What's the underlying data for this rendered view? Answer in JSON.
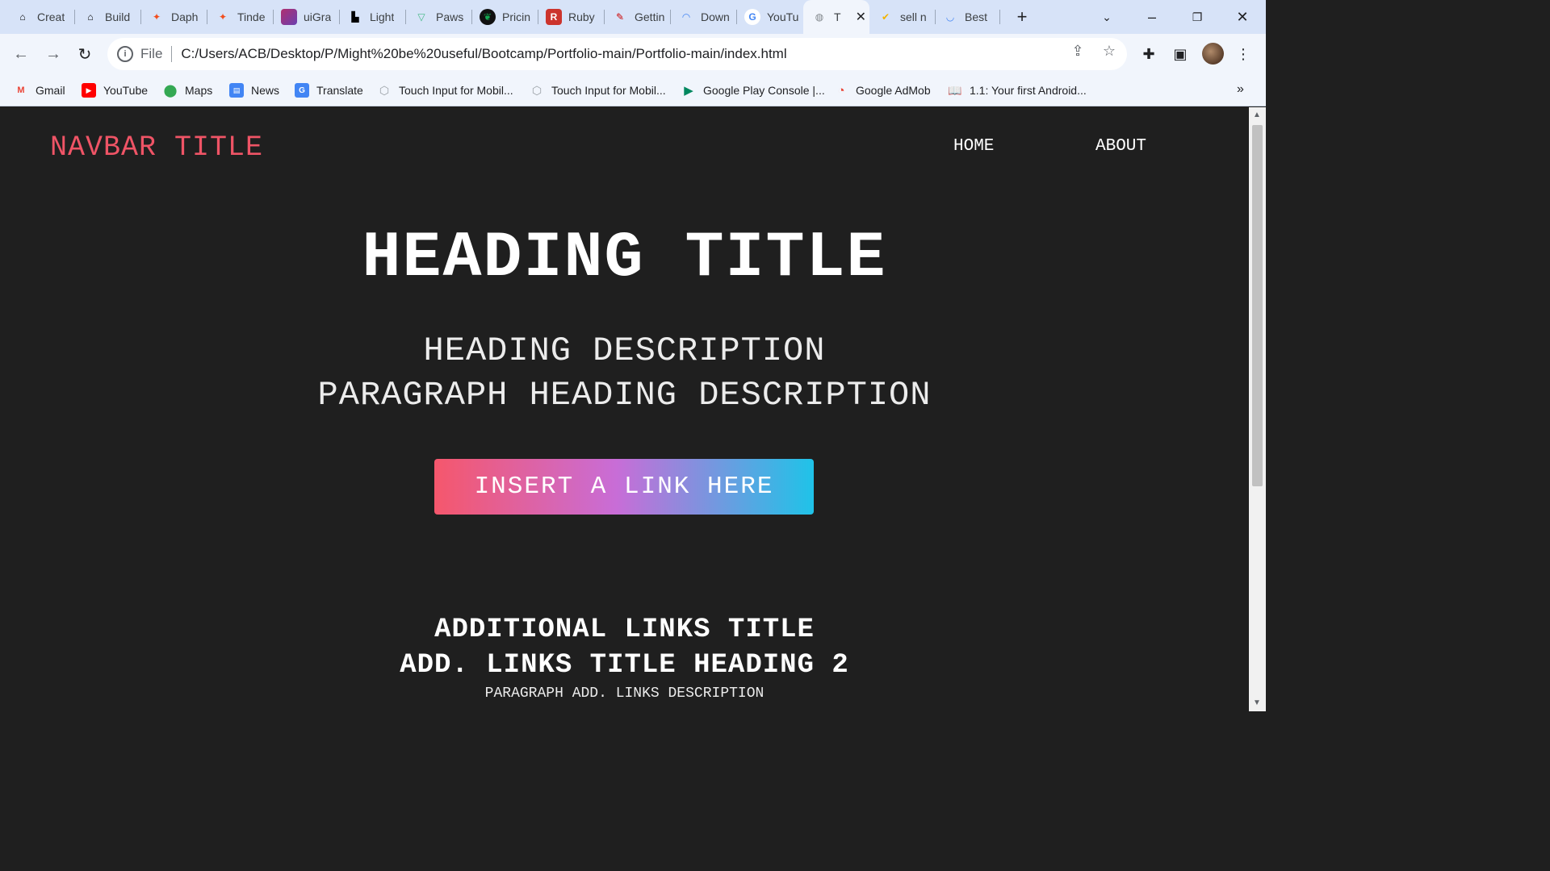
{
  "browser": {
    "tabs": [
      {
        "title": "Creat",
        "icon": "maze-icon",
        "color": "#202124"
      },
      {
        "title": "Build",
        "icon": "maze-icon",
        "color": "#202124"
      },
      {
        "title": "Daph",
        "icon": "figma-icon",
        "color": "#f24e1e"
      },
      {
        "title": "Tinde",
        "icon": "figma-icon",
        "color": "#f24e1e"
      },
      {
        "title": "uiGra",
        "icon": "uigradient-icon",
        "color": "#b0306f"
      },
      {
        "title": "Light",
        "icon": "lighthouse-icon",
        "color": "#000000"
      },
      {
        "title": "Paws",
        "icon": "vue-icon",
        "color": "#42b883"
      },
      {
        "title": "Pricin",
        "icon": "mongodb-leaf-icon",
        "color": "#13aa52"
      },
      {
        "title": "Ruby",
        "icon": "ruby-icon",
        "color": "#cc342d"
      },
      {
        "title": "Gettin",
        "icon": "rails-icon",
        "color": "#cc0000"
      },
      {
        "title": "Down",
        "icon": "rainbow-icon",
        "color": "#4285f4"
      },
      {
        "title": "YouTu",
        "icon": "google-icon",
        "color": "#4285f4"
      },
      {
        "title": "T",
        "icon": "globe-icon",
        "color": "#80868b",
        "active": true
      },
      {
        "title": "sell n",
        "icon": "check-circle-icon",
        "color": "#f2b400"
      },
      {
        "title": "Best ",
        "icon": "loading-icon",
        "color": "#4285f4"
      }
    ],
    "address": {
      "scheme": "File",
      "url": "C:/Users/ACB/Desktop/P/Might%20be%20useful/Bootcamp/Portfolio-main/Portfolio-main/index.html"
    },
    "bookmarks": [
      {
        "label": "Gmail",
        "icon": "gmail-icon",
        "color": "#ea4335"
      },
      {
        "label": "YouTube",
        "icon": "youtube-icon",
        "color": "#ff0000"
      },
      {
        "label": "Maps",
        "icon": "maps-pin-icon",
        "color": "#34a853"
      },
      {
        "label": "News",
        "icon": "news-icon",
        "color": "#4285f4"
      },
      {
        "label": "Translate",
        "icon": "translate-icon",
        "color": "#4285f4"
      },
      {
        "label": "Touch Input for Mobil...",
        "icon": "unity-icon",
        "color": "#9aa0a6"
      },
      {
        "label": "Touch Input for Mobil...",
        "icon": "unity-icon",
        "color": "#9aa0a6"
      },
      {
        "label": "Google Play Console |...",
        "icon": "play-icon",
        "color": "#01875f"
      },
      {
        "label": "Google AdMob",
        "icon": "admob-icon",
        "color": "#ea4335"
      },
      {
        "label": "1.1: Your first Android...",
        "icon": "book-icon",
        "color": "#5f6368"
      }
    ]
  },
  "page": {
    "navbar": {
      "title": "NAVBAR TITLE",
      "links": [
        "HOME",
        "ABOUT"
      ]
    },
    "hero": {
      "title": "HEADING TITLE",
      "description": "HEADING DESCRIPTION",
      "paragraph": "PARAGRAPH HEADING DESCRIPTION",
      "cta": "INSERT A LINK HERE"
    },
    "additional": {
      "title": "ADDITIONAL LINKS TITLE",
      "heading2": "ADD. LINKS TITLE HEADING 2",
      "description": "PARAGRAPH ADD. LINKS DESCRIPTION"
    }
  }
}
